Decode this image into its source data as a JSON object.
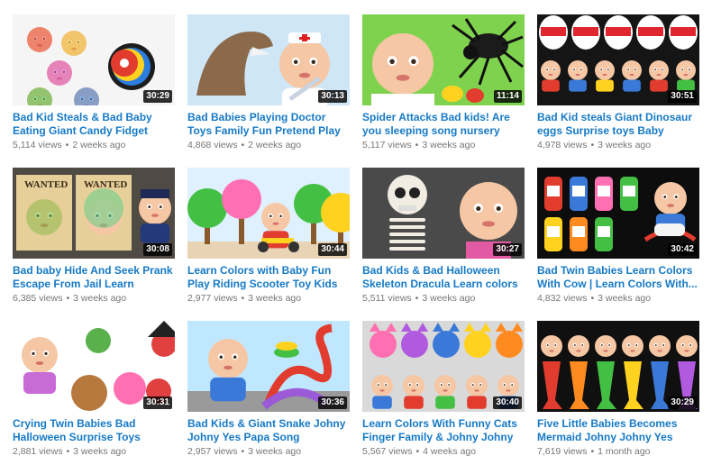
{
  "videos": [
    {
      "title": "Bad Kid Steals & Bad Baby Eating Giant Candy Fidget Spinner Lear...",
      "views": "5,114 views",
      "age": "2 weeks ago",
      "duration": "30:29",
      "bg": "#f5f5f5"
    },
    {
      "title": "Bad Babies Playing Doctor Toys Family Fun Pretend Play Childre...",
      "views": "4,868 views",
      "age": "2 weeks ago",
      "duration": "30:13",
      "bg": "#cfe6f7"
    },
    {
      "title": "Spider Attacks Bad kids! Are you sleeping song nursery rhymes f...",
      "views": "5,117 views",
      "age": "3 weeks ago",
      "duration": "11:14",
      "bg": "#7fd24e"
    },
    {
      "title": "Bad Kid steals Giant Dinosaur eggs Surprise toys Baby songs...",
      "views": "4,978 views",
      "age": "3 weeks ago",
      "duration": "30:51",
      "bg": "#1b1b1b"
    },
    {
      "title": "Bad baby Hide And Seek Prank Escape From Jail Learn colors...",
      "views": "6,385 views",
      "age": "3 weeks ago",
      "duration": "30:08",
      "bg": "#4f4a44"
    },
    {
      "title": "Learn Colors with Baby Fun Play Riding Scooter Toy Kids Indoor...",
      "views": "2,977 views",
      "age": "3 weeks ago",
      "duration": "30:44",
      "bg": "#dff1ff"
    },
    {
      "title": "Bad Kids & Bad Halloween Skeleton Dracula Learn colors f...",
      "views": "5,511 views",
      "age": "3 weeks ago",
      "duration": "30:27",
      "bg": "#3f3f3f"
    },
    {
      "title": "Bad Twin Babies Learn Colors With Cow | Learn Colors With...",
      "views": "4,832 views",
      "age": "3 weeks ago",
      "duration": "30:42",
      "bg": "#0d0d0d"
    },
    {
      "title": "Crying Twin Babies Bad Halloween Surprise Toys Johny...",
      "views": "2,881 views",
      "age": "3 weeks ago",
      "duration": "30:31",
      "bg": "#ffffff"
    },
    {
      "title": "Bad Kids & Giant Snake Johny Johny Yes Papa Song Nursery...",
      "views": "2,957 views",
      "age": "3 weeks ago",
      "duration": "30:36",
      "bg": "#bfe7ff"
    },
    {
      "title": "Learn Colors With Funny Cats Finger Family & Johny Johny Ye...",
      "views": "5,567 views",
      "age": "4 weeks ago",
      "duration": "30:40",
      "bg": "#d9d9d9"
    },
    {
      "title": "Five Little Babies Becomes Mermaid Johny Johny Yes Papa...",
      "views": "7,619 views",
      "age": "1 month ago",
      "duration": "30:29",
      "bg": "#101010"
    }
  ],
  "colors": {
    "title": "#167ac6",
    "meta": "#767676"
  }
}
